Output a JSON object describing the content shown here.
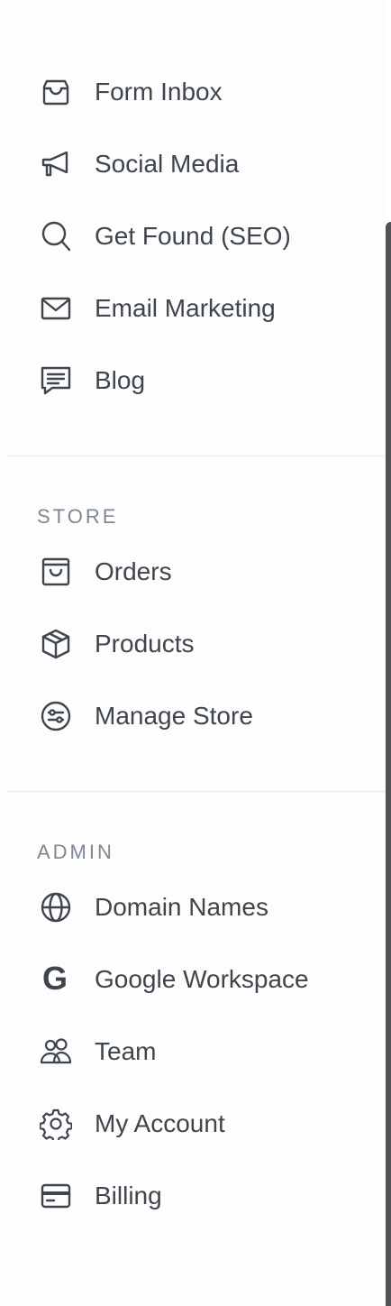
{
  "colors": {
    "text": "#3f454d",
    "section_title": "#7e8893",
    "divider": "#e7e9ec",
    "scrollbar": "#4f5358"
  },
  "marketing": {
    "items": [
      {
        "label": "Form Inbox",
        "icon": "inbox-icon"
      },
      {
        "label": "Social Media",
        "icon": "megaphone-icon"
      },
      {
        "label": "Get Found (SEO)",
        "icon": "search-icon"
      },
      {
        "label": "Email Marketing",
        "icon": "envelope-icon"
      },
      {
        "label": "Blog",
        "icon": "chat-lines-icon"
      }
    ]
  },
  "store": {
    "title": "STORE",
    "items": [
      {
        "label": "Orders",
        "icon": "shopping-bag-icon"
      },
      {
        "label": "Products",
        "icon": "box-icon"
      },
      {
        "label": "Manage Store",
        "icon": "sliders-circle-icon"
      }
    ]
  },
  "admin": {
    "title": "ADMIN",
    "items": [
      {
        "label": "Domain Names",
        "icon": "globe-icon"
      },
      {
        "label": "Google Workspace",
        "icon": "google-icon",
        "icon_glyph": "G"
      },
      {
        "label": "Team",
        "icon": "users-icon"
      },
      {
        "label": "My Account",
        "icon": "gear-icon"
      },
      {
        "label": "Billing",
        "icon": "credit-card-icon"
      }
    ]
  }
}
